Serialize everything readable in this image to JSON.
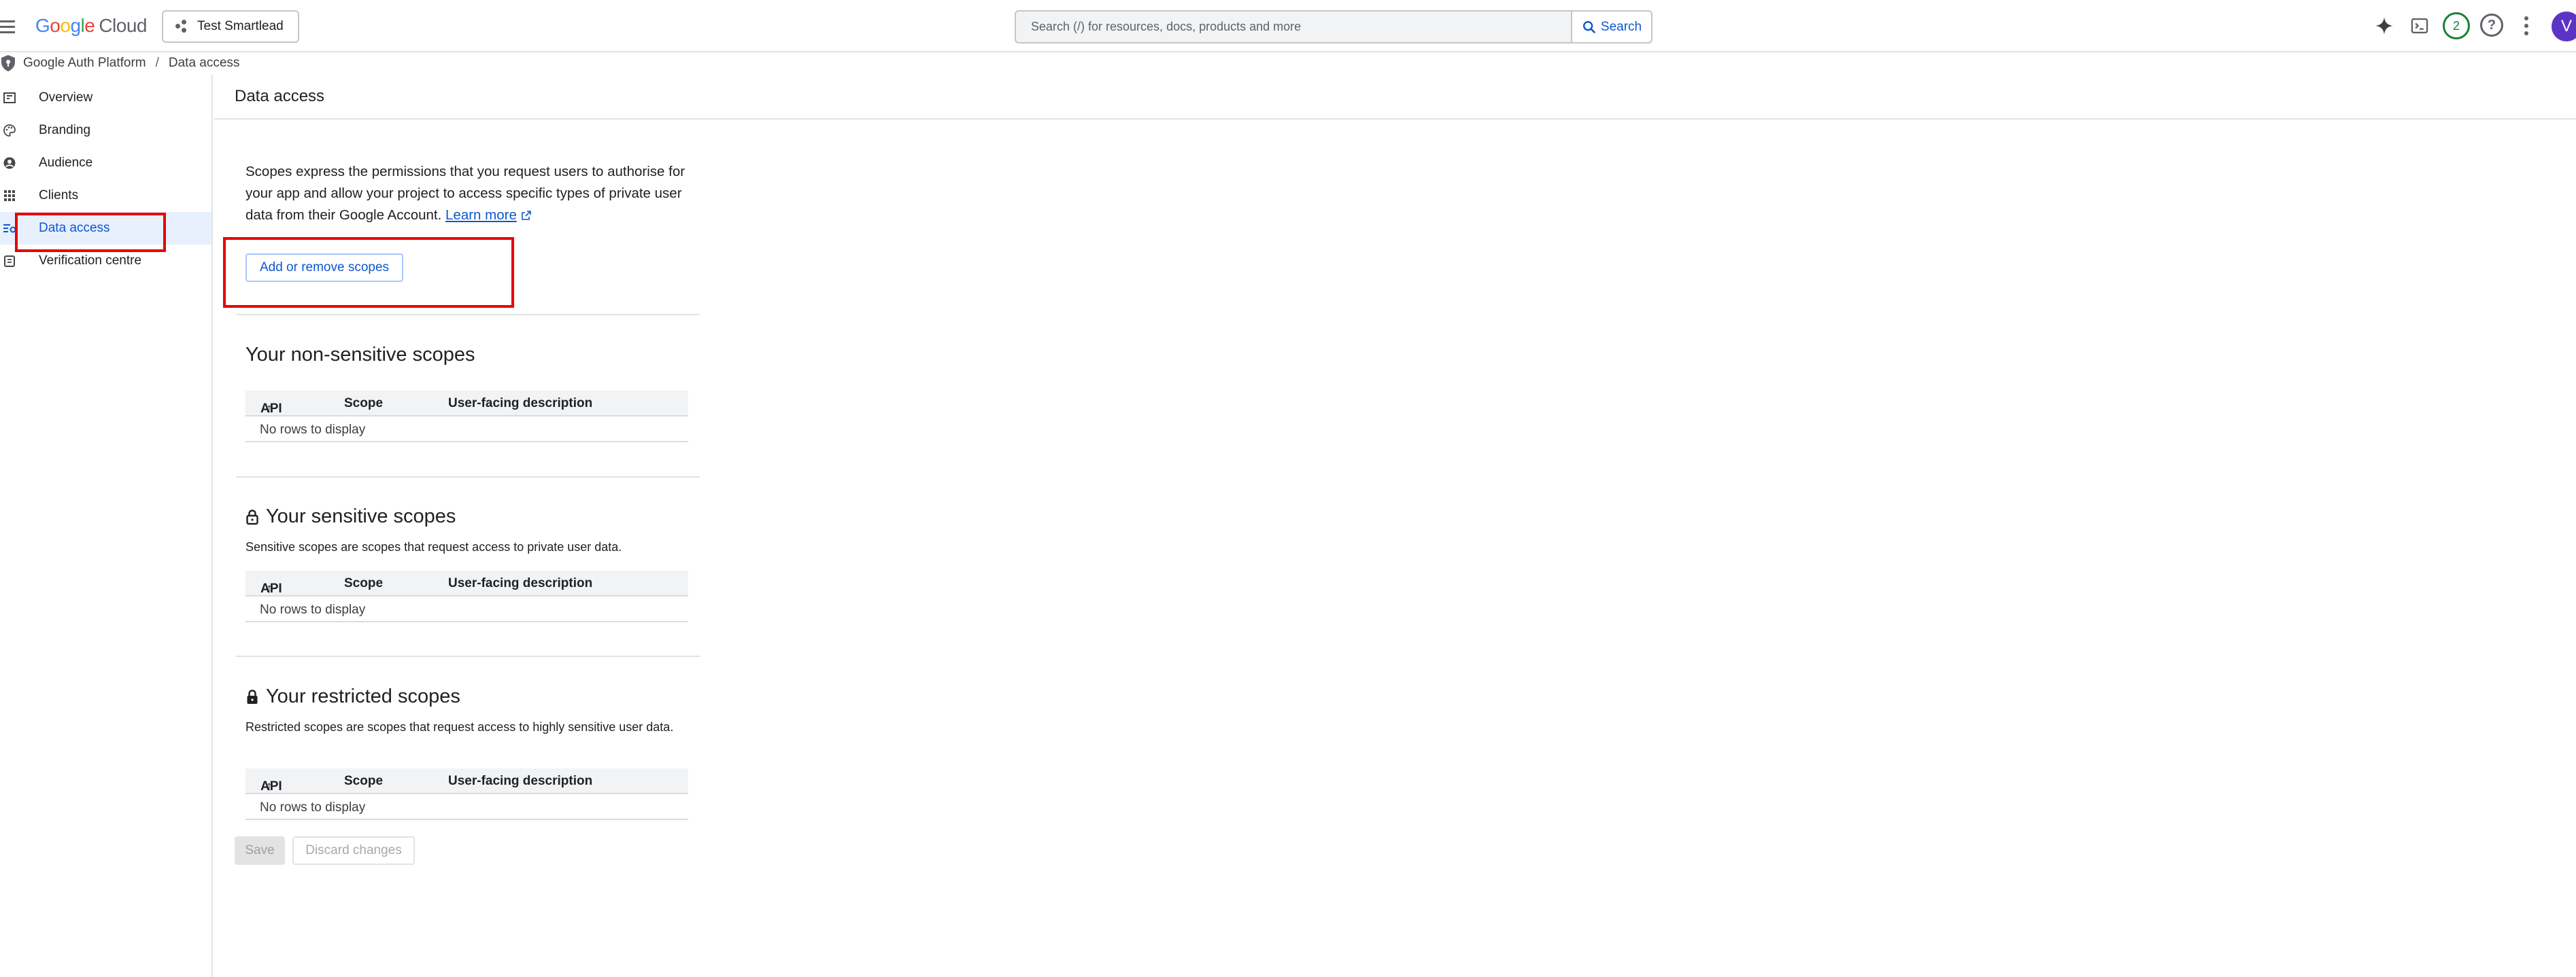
{
  "topbar": {
    "logo_google": "Google",
    "logo_cloud": "Cloud",
    "project_name": "Test Smartlead",
    "search_placeholder": "Search (/) for resources, docs, products and more",
    "search_button": "Search",
    "notification_count": "2",
    "avatar_initial": "V"
  },
  "breadcrumb": {
    "root": "Google Auth Platform",
    "separator": "/",
    "current": "Data access"
  },
  "sidebar": {
    "items": [
      {
        "label": "Overview",
        "icon": "dashboard-icon"
      },
      {
        "label": "Branding",
        "icon": "palette-icon"
      },
      {
        "label": "Audience",
        "icon": "account-circle-icon"
      },
      {
        "label": "Clients",
        "icon": "apps-grid-icon"
      },
      {
        "label": "Data access",
        "icon": "data-access-icon",
        "active": true
      },
      {
        "label": "Verification centre",
        "icon": "checklist-icon"
      }
    ]
  },
  "main": {
    "title": "Data access",
    "intro_text": "Scopes express the permissions that you request users to authorise for your app and allow your project to access specific types of private user data from their Google Account.",
    "learn_more": "Learn more",
    "add_scopes_button": "Add or remove scopes",
    "table_columns": {
      "api": "API",
      "scope": "Scope",
      "description": "User-facing description"
    },
    "empty_text": "No rows to display",
    "sections": {
      "non_sensitive": {
        "title": "Your non-sensitive scopes"
      },
      "sensitive": {
        "title": "Your sensitive scopes",
        "description": "Sensitive scopes are scopes that request access to private user data."
      },
      "restricted": {
        "title": "Your restricted scopes",
        "description": "Restricted scopes are scopes that request access to highly sensitive user data."
      }
    },
    "save_button": "Save",
    "discard_button": "Discard changes"
  },
  "colors": {
    "accent": "#0b57d0",
    "highlight_box": "#e8000b",
    "active_bg": "#e8f0fe",
    "avatar_bg": "#5b34c6"
  }
}
